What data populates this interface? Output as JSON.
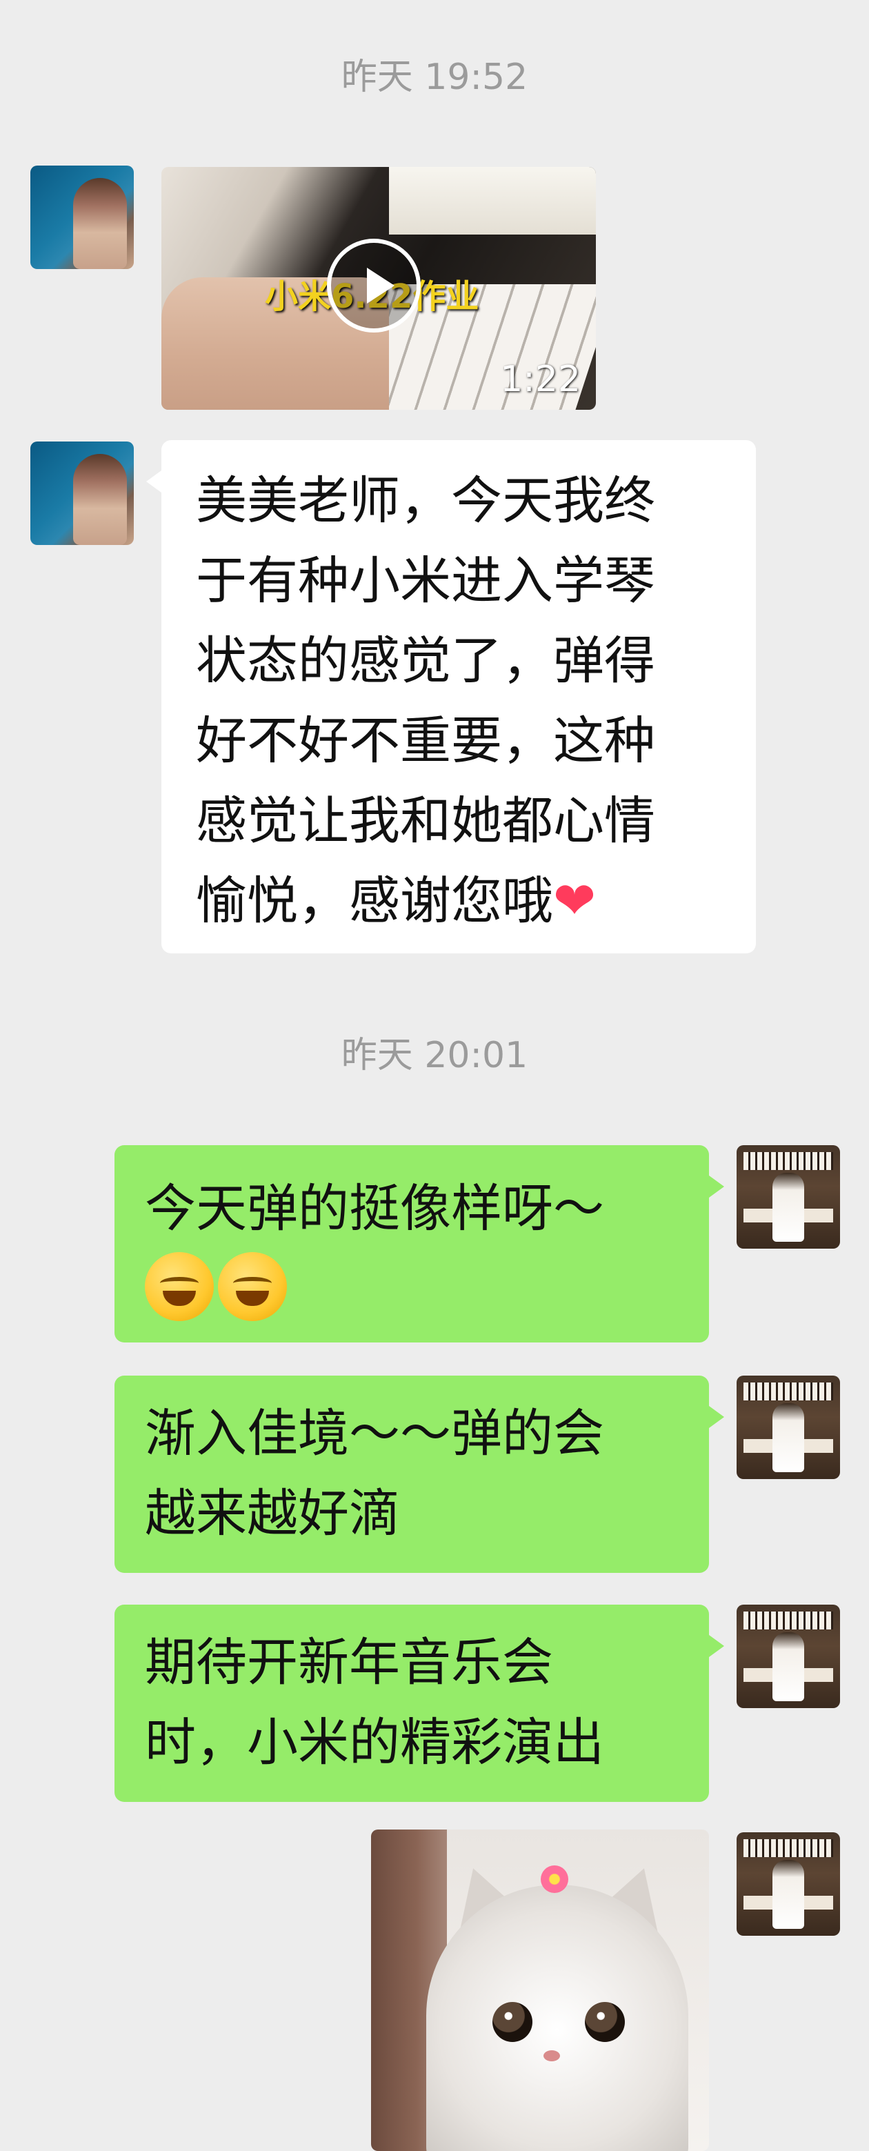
{
  "timestamps": [
    "昨天 19:52",
    "昨天 20:01"
  ],
  "video_message": {
    "caption": "小米6.22作业",
    "duration": "1:22"
  },
  "incoming_text": {
    "lines": [
      "美美老师，今天我终",
      "于有种小米进入学琴",
      "状态的感觉了，弹得",
      "好不好不重要，这种",
      "感觉让我和她都心情",
      "愉悦，感谢您哦"
    ],
    "trailing_emoji": "❤"
  },
  "outgoing_messages": [
    {
      "lines": [
        "今天弹的挺像样呀～"
      ],
      "emoji_count": 2
    },
    {
      "lines": [
        "渐入佳境～～弹的会",
        "越来越好滴"
      ]
    },
    {
      "lines": [
        "期待开新年音乐会",
        "时，小米的精彩演出"
      ]
    }
  ],
  "icons": {
    "play": "play-icon",
    "heart": "heart-emoji",
    "smile": "smile-emoji"
  },
  "colors": {
    "background": "#ededed",
    "outgoing_bubble": "#95ec69",
    "incoming_bubble": "#ffffff",
    "timestamp": "#9b9b9b"
  }
}
